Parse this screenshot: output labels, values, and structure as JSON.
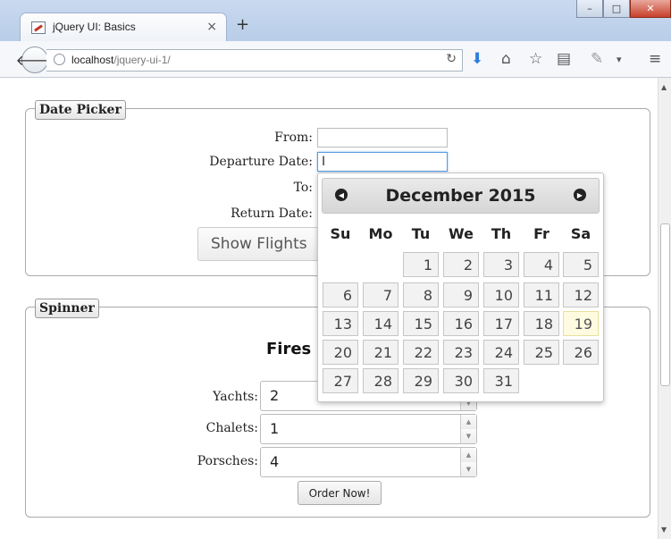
{
  "browser": {
    "tab_title": "jQuery UI: Basics",
    "tab_close": "×",
    "new_tab": "+",
    "url_host": "localhost",
    "url_path": "/jquery-ui-1/",
    "window_buttons": {
      "minimize": "–",
      "maximize": "□",
      "close": "✕"
    }
  },
  "date_picker": {
    "legend": "Date Picker",
    "labels": {
      "from": "From:",
      "departure": "Departure Date:",
      "to": "To:",
      "return": "Return Date:"
    },
    "show_flights_button": "Show Flights"
  },
  "calendar": {
    "title": "December 2015",
    "prev": "◀",
    "next": "▶",
    "weekdays": [
      "Su",
      "Mo",
      "Tu",
      "We",
      "Th",
      "Fr",
      "Sa"
    ],
    "weeks": [
      [
        "",
        "",
        "1",
        "2",
        "3",
        "4",
        "5"
      ],
      [
        "6",
        "7",
        "8",
        "9",
        "10",
        "11",
        "12"
      ],
      [
        "13",
        "14",
        "15",
        "16",
        "17",
        "18",
        "19"
      ],
      [
        "20",
        "21",
        "22",
        "23",
        "24",
        "25",
        "26"
      ],
      [
        "27",
        "28",
        "29",
        "30",
        "31",
        "",
        ""
      ]
    ],
    "highlighted_day": "19"
  },
  "spinner": {
    "legend": "Spinner",
    "heading": "Fires",
    "fields": [
      {
        "label": "Yachts:",
        "value": "2"
      },
      {
        "label": "Chalets:",
        "value": "1"
      },
      {
        "label": "Porsches:",
        "value": "4"
      }
    ],
    "order_button": "Order Now!"
  },
  "colors": {
    "highlight": "#fffbe0",
    "focus_border": "#5b9be0",
    "titlebar": "#c9daf0"
  }
}
